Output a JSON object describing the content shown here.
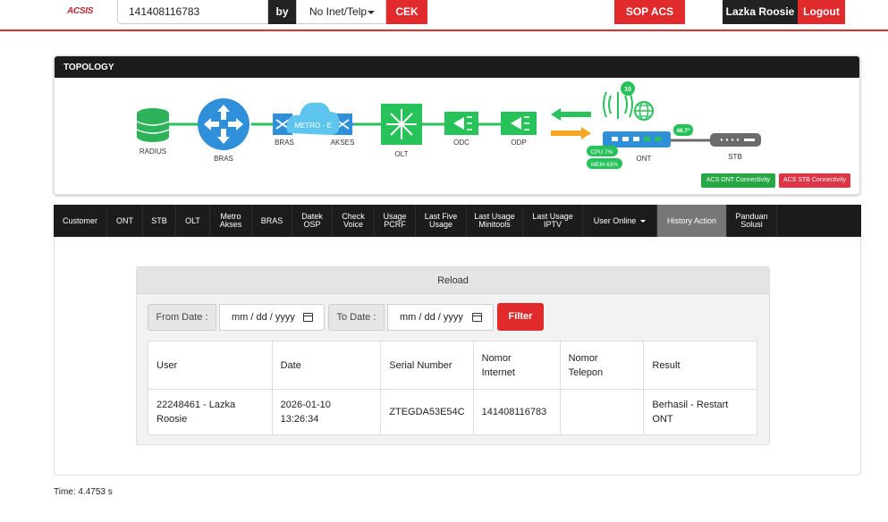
{
  "header": {
    "logo": "ACSIS",
    "search_value": "141408116783",
    "by_label": "by",
    "search_by": "No Inet/Telp",
    "cek_label": "CEK",
    "sop_label": "SOP ACS",
    "user_name": "Lazka Roosie",
    "logout_label": "Logout"
  },
  "topology": {
    "title": "TOPOLOGY",
    "nodes": {
      "radius": "RADIUS",
      "bras": "BRAS",
      "bras2": "BRAS",
      "metro": "METRO - E",
      "akses": "AKSES",
      "olt": "OLT",
      "odc": "ODC",
      "odp": "ODP",
      "ont": "ONT",
      "stb": "STB"
    },
    "wifi_count": "10",
    "temperature": "46.7°",
    "cpu": "CPU 7%",
    "mem": "MEM 63%",
    "acs_ont": "ACS ONT Connectivity",
    "acs_stb": "ACS STB Connectivity",
    "colors": {
      "ok": "#28a745",
      "fail": "#dc3545",
      "net_blue": "#2f8fd8",
      "orange": "#f5a623"
    }
  },
  "tabs": [
    {
      "l1": "Customer",
      "l2": ""
    },
    {
      "l1": "ONT",
      "l2": ""
    },
    {
      "l1": "STB",
      "l2": ""
    },
    {
      "l1": "OLT",
      "l2": ""
    },
    {
      "l1": "Metro",
      "l2": "Akses"
    },
    {
      "l1": "BRAS",
      "l2": ""
    },
    {
      "l1": "Datek",
      "l2": "OSP"
    },
    {
      "l1": "Check",
      "l2": "Voice"
    },
    {
      "l1": "Usage",
      "l2": "PCRF"
    },
    {
      "l1": "Last Five",
      "l2": "Usage"
    },
    {
      "l1": "Last Usage",
      "l2": "Minitools"
    },
    {
      "l1": "Last Usage",
      "l2": "IPTV"
    },
    {
      "l1": "User Online",
      "l2": ""
    },
    {
      "l1": "History Action",
      "l2": ""
    },
    {
      "l1": "Panduan",
      "l2": "Solusi"
    }
  ],
  "history": {
    "reload_label": "Reload",
    "from_label": "From Date :",
    "from_value": "mm / dd / yyyy",
    "to_label": "To Date :",
    "to_value": "mm / dd / yyyy",
    "filter_label": "Filter",
    "columns": [
      {
        "l1": "User",
        "l2": ""
      },
      {
        "l1": "Date",
        "l2": ""
      },
      {
        "l1": "Serial Number",
        "l2": ""
      },
      {
        "l1": "Nomor",
        "l2": "Internet"
      },
      {
        "l1": "Nomor",
        "l2": "Telepon"
      },
      {
        "l1": "Result",
        "l2": ""
      }
    ],
    "rows": [
      {
        "user_l1": "22248461 - Lazka",
        "user_l2": "Roosie",
        "date_l1": "2026-01-10",
        "date_l2": "13:26:34",
        "serial": "ZTEGDA53E54C",
        "internet": "141408116783",
        "telepon": "",
        "result_l1": "Berhasil - Restart",
        "result_l2": "ONT"
      }
    ]
  },
  "footer": {
    "time": "Time: 4.4753 s"
  }
}
